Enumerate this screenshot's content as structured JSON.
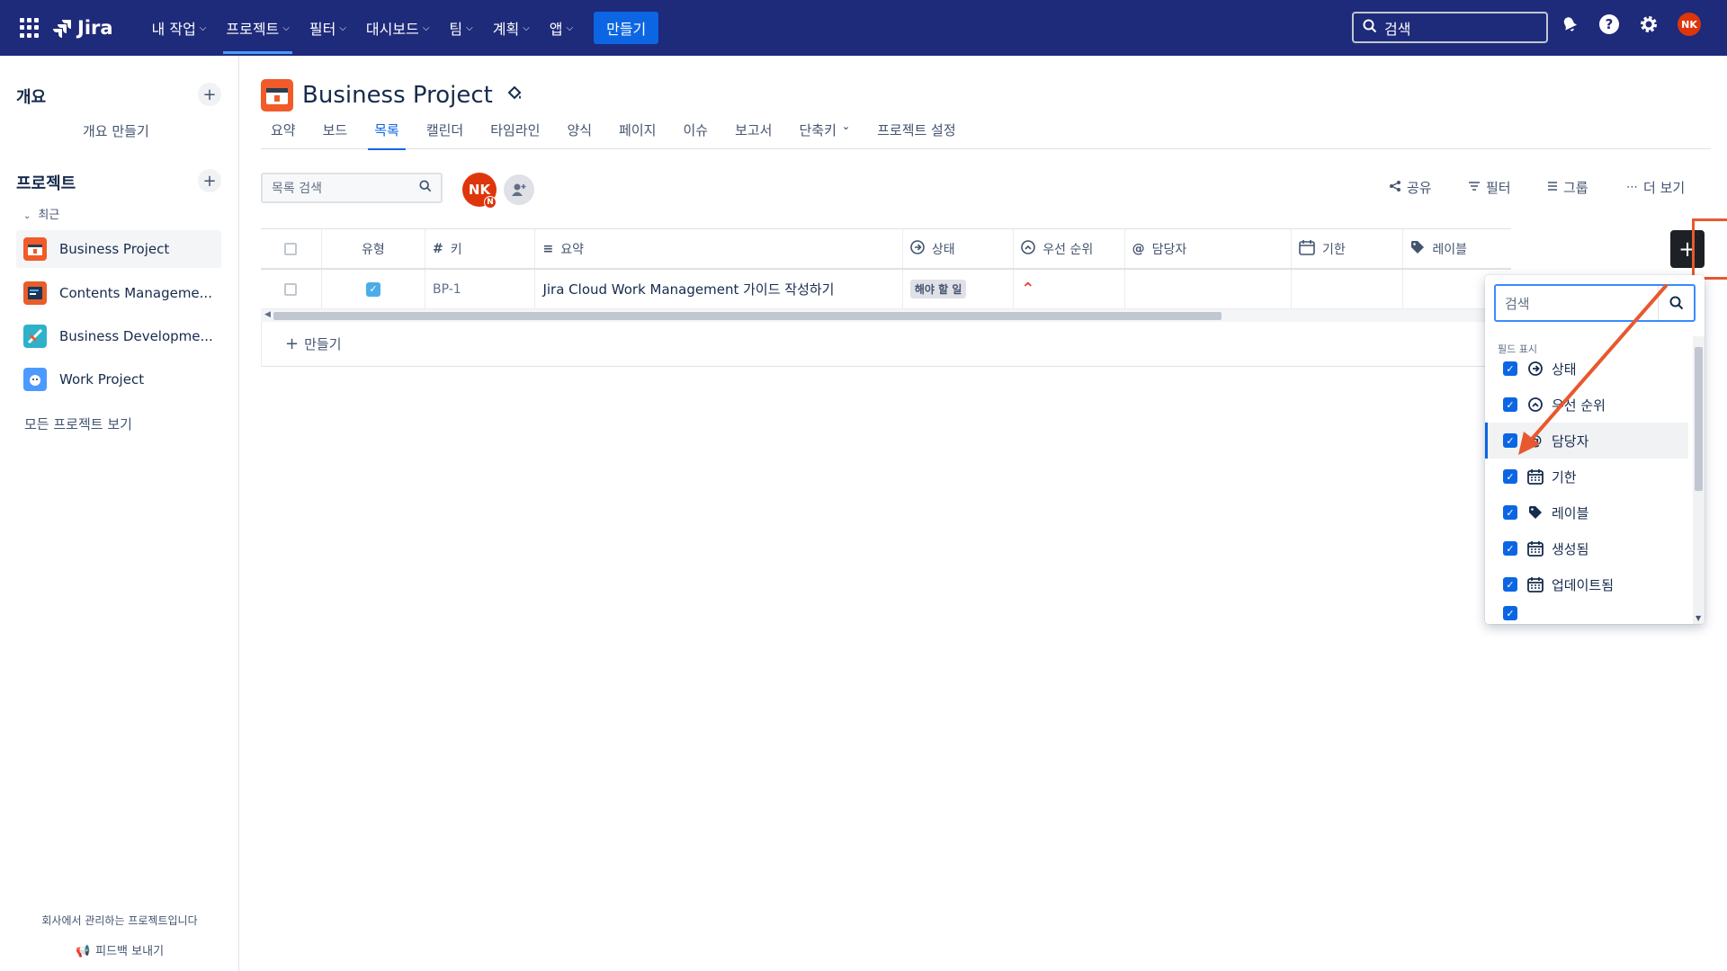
{
  "topnav": {
    "logo": "Jira",
    "menu": [
      {
        "label": "내 작업",
        "name": "nav-my-work"
      },
      {
        "label": "프로젝트",
        "name": "nav-projects"
      },
      {
        "label": "필터",
        "name": "nav-filters"
      },
      {
        "label": "대시보드",
        "name": "nav-dashboards"
      },
      {
        "label": "팀",
        "name": "nav-teams"
      },
      {
        "label": "계획",
        "name": "nav-plans"
      },
      {
        "label": "앱",
        "name": "nav-apps"
      }
    ],
    "create_label": "만들기",
    "search_placeholder": "검색",
    "user_initials": "NK"
  },
  "sidebar": {
    "overview_title": "개요",
    "overview_create": "개요 만들기",
    "projects_title": "프로젝트",
    "recent_label": "최근",
    "projects": [
      {
        "label": "Business Project",
        "color": "#f15b2a"
      },
      {
        "label": "Contents Manageme...",
        "color": "#e85d2a"
      },
      {
        "label": "Business Developme...",
        "color": "#2fb2c9"
      },
      {
        "label": "Work Project",
        "color": "#4c9aff"
      }
    ],
    "view_all": "모든 프로젝트 보기",
    "footer_note": "회사에서 관리하는 프로젝트입니다",
    "feedback": "피드백 보내기"
  },
  "project": {
    "title": "Business Project",
    "tabs": [
      "요약",
      "보드",
      "목록",
      "캘린더",
      "타임라인",
      "양식",
      "페이지",
      "이슈",
      "보고서",
      "단축키",
      "프로젝트 설정"
    ],
    "active_tab": "목록"
  },
  "list": {
    "search_placeholder": "목록 검색",
    "avatar_initials": "NK",
    "avatar_mini": "N",
    "toolbar": {
      "share": "공유",
      "filter": "필터",
      "group": "그룹",
      "more": "더 보기"
    },
    "columns": {
      "type": "유형",
      "key": "키",
      "summary": "요약",
      "status": "상태",
      "priority": "우선 순위",
      "assignee": "담당자",
      "due": "기한",
      "labels": "레이블"
    },
    "rows": [
      {
        "key": "BP-1",
        "summary": "Jira Cloud Work Management 가이드 작성하기",
        "status": "해야 할 일"
      }
    ],
    "create_label": "만들기"
  },
  "field_dropdown": {
    "search_placeholder": "검색",
    "section_label": "필드 표시",
    "fields": [
      {
        "label": "상태",
        "icon": "status-icon"
      },
      {
        "label": "우선 순위",
        "icon": "priority-icon"
      },
      {
        "label": "담당자",
        "icon": "at-icon"
      },
      {
        "label": "기한",
        "icon": "calendar-icon"
      },
      {
        "label": "레이블",
        "icon": "tag-icon"
      },
      {
        "label": "생성됨",
        "icon": "calendar-icon"
      },
      {
        "label": "업데이트됨",
        "icon": "calendar-icon"
      }
    ]
  },
  "colors": {
    "nav_bg": "#1e2a7a",
    "accent": "#0c66e4",
    "annotation": "#e8582f"
  }
}
